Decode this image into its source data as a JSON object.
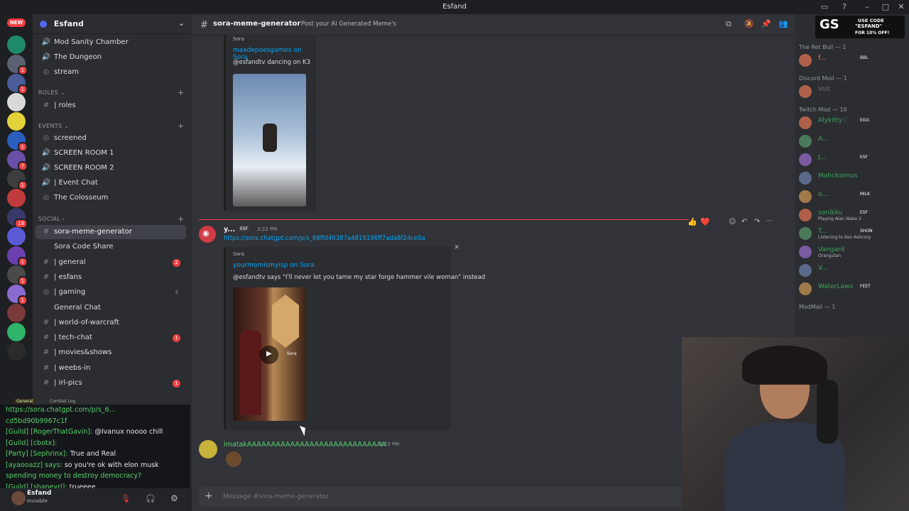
{
  "window": {
    "title": "Esfand"
  },
  "guild": {
    "name": "Esfand",
    "new_badge": "NEW"
  },
  "server_rail": [
    {
      "name": "server-1",
      "color": "#1f8a6b",
      "badge": ""
    },
    {
      "name": "server-2",
      "color": "#5b6170",
      "badge": "1"
    },
    {
      "name": "server-3",
      "color": "#4a5d9a",
      "badge": "1"
    },
    {
      "name": "server-4",
      "color": "#d9d9d9",
      "badge": ""
    },
    {
      "name": "server-5",
      "color": "#e2d33a",
      "badge": ""
    },
    {
      "name": "server-6",
      "color": "#2a5fbf",
      "badge": "1"
    },
    {
      "name": "server-7",
      "color": "#6a4fa8",
      "badge": "7"
    },
    {
      "name": "server-8",
      "color": "#3d3d3d",
      "badge": "1"
    },
    {
      "name": "server-9",
      "color": "#c03b3b",
      "badge": ""
    },
    {
      "name": "server-10",
      "color": "#3a3a6a",
      "badge": "19"
    },
    {
      "name": "server-11",
      "color": "#5b5bd6",
      "badge": ""
    },
    {
      "name": "server-12",
      "color": "#6c3fb0",
      "badge": "1"
    },
    {
      "name": "server-13",
      "color": "#4a4a4a",
      "badge": "1"
    },
    {
      "name": "server-14",
      "color": "#8b6bd1",
      "badge": "1"
    },
    {
      "name": "server-15",
      "color": "#7a3a3a",
      "badge": ""
    },
    {
      "name": "server-16",
      "color": "#2fb36a",
      "badge": ""
    },
    {
      "name": "server-17",
      "color": "#2b2b2b",
      "badge": ""
    }
  ],
  "channels": {
    "top": [
      {
        "label": "Mod Sanity Chamber",
        "glyph": "🔊"
      },
      {
        "label": "The Dungeon",
        "glyph": "🔊"
      },
      {
        "label": "stream",
        "glyph": "◎"
      }
    ],
    "roles_cat": "ROLES ⌄",
    "roles": [
      {
        "label": "| roles",
        "glyph": "#"
      }
    ],
    "events_cat": "EVENTS ⌄",
    "events": [
      {
        "label": "screened",
        "glyph": "◎"
      },
      {
        "label": "SCREEN ROOM 1",
        "glyph": "🔊"
      },
      {
        "label": "SCREEN ROOM 2",
        "glyph": "🔊"
      },
      {
        "label": "| Event Chat",
        "glyph": "🔊"
      },
      {
        "label": "The Colosseum",
        "glyph": "◎"
      }
    ],
    "social_cat": "SOCIAL ›",
    "social": [
      {
        "label": "sora-meme-generator",
        "glyph": "#",
        "active": true,
        "count": ""
      },
      {
        "label": "Sora Code Share",
        "glyph": "",
        "count": ""
      },
      {
        "label": "| general",
        "glyph": "#",
        "count": "2"
      },
      {
        "label": "| esfans",
        "glyph": "#",
        "count": ""
      },
      {
        "label": "| gaming",
        "glyph": "◎",
        "count": "3"
      },
      {
        "label": "General Chat",
        "glyph": "",
        "count": ""
      },
      {
        "label": "| world-of-warcraft",
        "glyph": "#",
        "count": ""
      },
      {
        "label": "| tech-chat",
        "glyph": "#",
        "count": "1"
      },
      {
        "label": "| movies&shows",
        "glyph": "#",
        "count": ""
      },
      {
        "label": "| weebs-in",
        "glyph": "#",
        "count": ""
      },
      {
        "label": "| irl-pics",
        "glyph": "#",
        "count": "1"
      }
    ]
  },
  "chat_overlay": {
    "tabs": [
      "General",
      "Combat Log"
    ],
    "lines": [
      {
        "prefix": "",
        "text": "https://sora.chatgpt.com/p/s_6..."
      },
      {
        "prefix": "",
        "text": "cd5bd90b9967c1f"
      },
      {
        "prefix": "[Guild] [RogerThatGavin]:",
        "text": "@Ivanux noooo chill"
      },
      {
        "prefix": "[Guild] [cbotx]:",
        "text": ""
      },
      {
        "prefix": "[Party] [Sephrinx]:",
        "text": "True and Real"
      },
      {
        "prefix": "[ayaooazz] says:",
        "text": "so you're ok with elon musk"
      },
      {
        "prefix": "",
        "text": "spending money to destroy democracy?"
      },
      {
        "prefix": "[Guild] [shaneyrl]:",
        "text": "trueeee"
      }
    ]
  },
  "user_panel": {
    "name": "Esfand",
    "status": "Invisible"
  },
  "channel_header": {
    "name": "sora-meme-generator",
    "topic": "Post your AI Generated Meme's",
    "search": "Search"
  },
  "messages": [
    {
      "embed_provider": "Sora",
      "embed_title": "maxdepoesgames on Sora",
      "embed_desc": "@esfandtv dancing on K3"
    },
    {
      "author": "y...",
      "tag": "ESF",
      "time": "3:22 PM",
      "link": "https://sora.chatgpt.com/p/s_68ffd40387a4819196ff7ada8f24ce0a",
      "embed_provider": "Sora",
      "embed_title": "yourmomismyisp on Sora",
      "embed_desc": "@esfandtv says \"I'll never let you tame my star forge hammer vile woman\" instead",
      "video_watermark": "Sora"
    },
    {
      "author": "imatakAAAAAAAAAAAAAAAAAAAAAAAAAAAAA",
      "time": "3:23 PM"
    }
  ],
  "reactions": [
    "👍",
    "❤️"
  ],
  "composer": {
    "placeholder": "Message #sora-meme-generator"
  },
  "members": {
    "groups": [
      {
        "label": "The Ret Bull — 1",
        "members": [
          {
            "name": "f...",
            "tag": "BBL",
            "color": "#f07a7a",
            "sub": ""
          }
        ]
      },
      {
        "label": "Discord Mod — 1",
        "members": [
          {
            "name": "Volt",
            "tag": "",
            "color": "#6d6f78",
            "sub": ""
          }
        ]
      },
      {
        "label": "Twitch Mod — 10",
        "members": [
          {
            "name": "Alykitty♡",
            "tag": "EGG",
            "color": "#3ba55c",
            "sub": ""
          },
          {
            "name": "A...",
            "tag": "",
            "color": "#3ba55c",
            "sub": ""
          },
          {
            "name": "J...",
            "tag": "ESF",
            "color": "#3ba55c",
            "sub": ""
          },
          {
            "name": "Mahcksimus",
            "tag": "",
            "color": "#3ba55c",
            "sub": ""
          },
          {
            "name": "o...",
            "tag": "MiLK",
            "color": "#3ba55c",
            "sub": ""
          },
          {
            "name": "sonikku",
            "tag": "ESF",
            "color": "#3ba55c",
            "sub": "Playing Alan Wake 2"
          },
          {
            "name": "T...",
            "tag": "SHON",
            "color": "#3ba55c",
            "sub": "Listening to Ken Ashcorp"
          },
          {
            "name": "Vangard",
            "tag": "",
            "color": "#3ba55c",
            "sub": "Orangutan"
          },
          {
            "name": "V...",
            "tag": "",
            "color": "#3ba55c",
            "sub": ""
          },
          {
            "name": "WaterLaws",
            "tag": "FEET",
            "color": "#3ba55c",
            "sub": ""
          }
        ]
      },
      {
        "label": "ModMail — 1",
        "members": []
      }
    ]
  },
  "promo": {
    "line1": "USE CODE",
    "line2": "\"ESFAND\"",
    "line3": "FOR 10% OFF!",
    "logo": "GS"
  }
}
